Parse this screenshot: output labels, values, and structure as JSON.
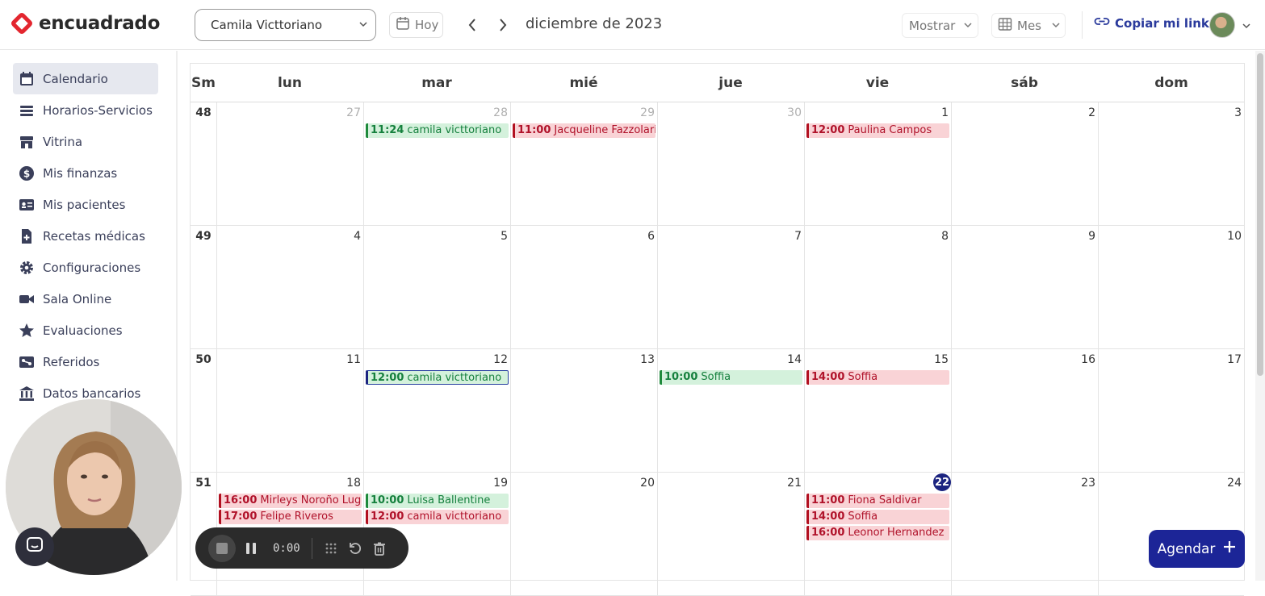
{
  "brand": {
    "name": "encuadrado",
    "accent": "#e3262f"
  },
  "header": {
    "user_select": "Camila Victtoriano",
    "today_label": "Hoy",
    "month_title": "diciembre de 2023",
    "show_label": "Mostrar",
    "view_label": "Mes",
    "copy_link_label": "Copiar mi link"
  },
  "sidebar": {
    "items": [
      {
        "label": "Calendario",
        "icon": "calendar-icon",
        "active": true
      },
      {
        "label": "Horarios-Servicios",
        "icon": "layers-icon"
      },
      {
        "label": "Vitrina",
        "icon": "storefront-icon"
      },
      {
        "label": "Mis finanzas",
        "icon": "dollar-icon"
      },
      {
        "label": "Mis pacientes",
        "icon": "id-card-icon"
      },
      {
        "label": "Recetas médicas",
        "icon": "prescription-icon"
      },
      {
        "label": "Configuraciones",
        "icon": "gear-icon"
      },
      {
        "label": "Sala Online",
        "icon": "video-icon"
      },
      {
        "label": "Evaluaciones",
        "icon": "star-icon"
      },
      {
        "label": "Referidos",
        "icon": "referral-icon"
      },
      {
        "label": "Datos bancarios",
        "icon": "bank-icon"
      }
    ]
  },
  "calendar": {
    "week_col_label": "Sm",
    "days": [
      "lun",
      "mar",
      "mié",
      "jue",
      "vie",
      "sáb",
      "dom"
    ],
    "weeks": [
      {
        "num": "48",
        "dates": [
          "27",
          "28",
          "29",
          "30",
          "1",
          "2",
          "3"
        ],
        "other_month": [
          true,
          true,
          true,
          true,
          false,
          false,
          false
        ]
      },
      {
        "num": "49",
        "dates": [
          "4",
          "5",
          "6",
          "7",
          "8",
          "9",
          "10"
        ]
      },
      {
        "num": "50",
        "dates": [
          "11",
          "12",
          "13",
          "14",
          "15",
          "16",
          "17"
        ]
      },
      {
        "num": "51",
        "dates": [
          "18",
          "19",
          "20",
          "21",
          "22",
          "23",
          "24"
        ],
        "today_index": 4
      }
    ],
    "events": {
      "w0": {
        "d1": [
          {
            "time": "11:24",
            "name": "camila victtoriano",
            "color": "green"
          }
        ],
        "d2": [
          {
            "time": "11:00",
            "name": "Jacqueline Fazzolari",
            "color": "red"
          }
        ],
        "d4": [
          {
            "time": "12:00",
            "name": "Paulina Campos",
            "color": "red"
          }
        ]
      },
      "w2": {
        "d1": [
          {
            "time": "12:00",
            "name": "camila victtoriano",
            "color": "green",
            "selected": true
          }
        ],
        "d3": [
          {
            "time": "10:00",
            "name": "Soffia",
            "color": "green"
          }
        ],
        "d4": [
          {
            "time": "14:00",
            "name": "Soffia",
            "color": "red"
          }
        ]
      },
      "w3": {
        "d0": [
          {
            "time": "16:00",
            "name": "Mirleys Noroño Lugo",
            "color": "red"
          },
          {
            "time": "17:00",
            "name": "Felipe Riveros",
            "color": "red"
          }
        ],
        "d1": [
          {
            "time": "10:00",
            "name": "Luisa Ballentine",
            "color": "green"
          },
          {
            "time": "12:00",
            "name": "camila victtoriano",
            "color": "red"
          }
        ],
        "d4": [
          {
            "time": "11:00",
            "name": "Fiona Saldivar",
            "color": "red"
          },
          {
            "time": "14:00",
            "name": "Soffia",
            "color": "red"
          },
          {
            "time": "16:00",
            "name": "Leonor Hernandez",
            "color": "red"
          }
        ]
      }
    }
  },
  "actions": {
    "schedule_label": "Agendar"
  },
  "recorder": {
    "time": "0:00"
  }
}
